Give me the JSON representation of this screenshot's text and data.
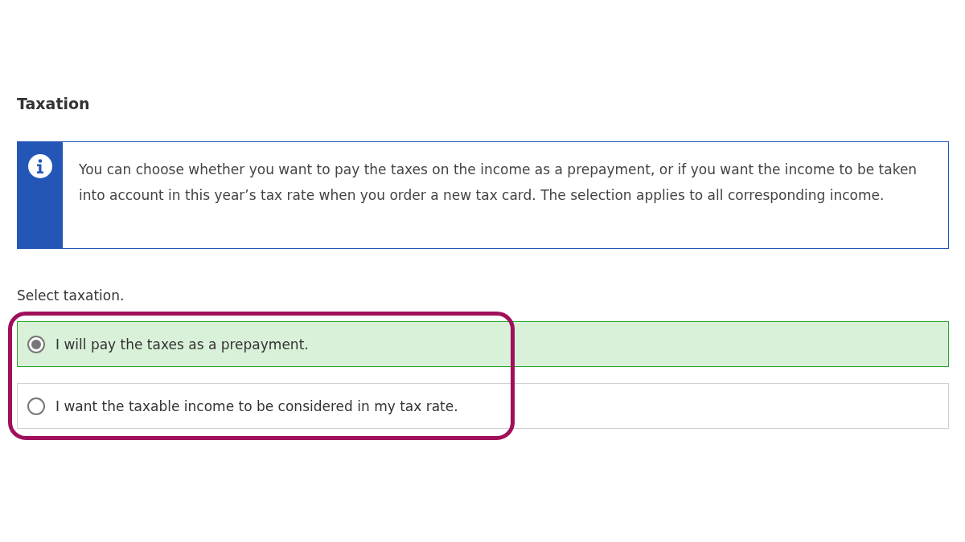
{
  "heading": "Taxation",
  "info": {
    "text": "You can choose whether you want to pay the taxes on the income as a prepayment, or if you want the income to be taken into account in this year’s tax rate when you order a new tax card. The selection applies to all corresponding income."
  },
  "question": "Select taxation.",
  "options": [
    {
      "label": "I will pay the taxes as a prepayment.",
      "selected": true
    },
    {
      "label": "I want the taxable income to be considered in my tax rate.",
      "selected": false
    }
  ]
}
